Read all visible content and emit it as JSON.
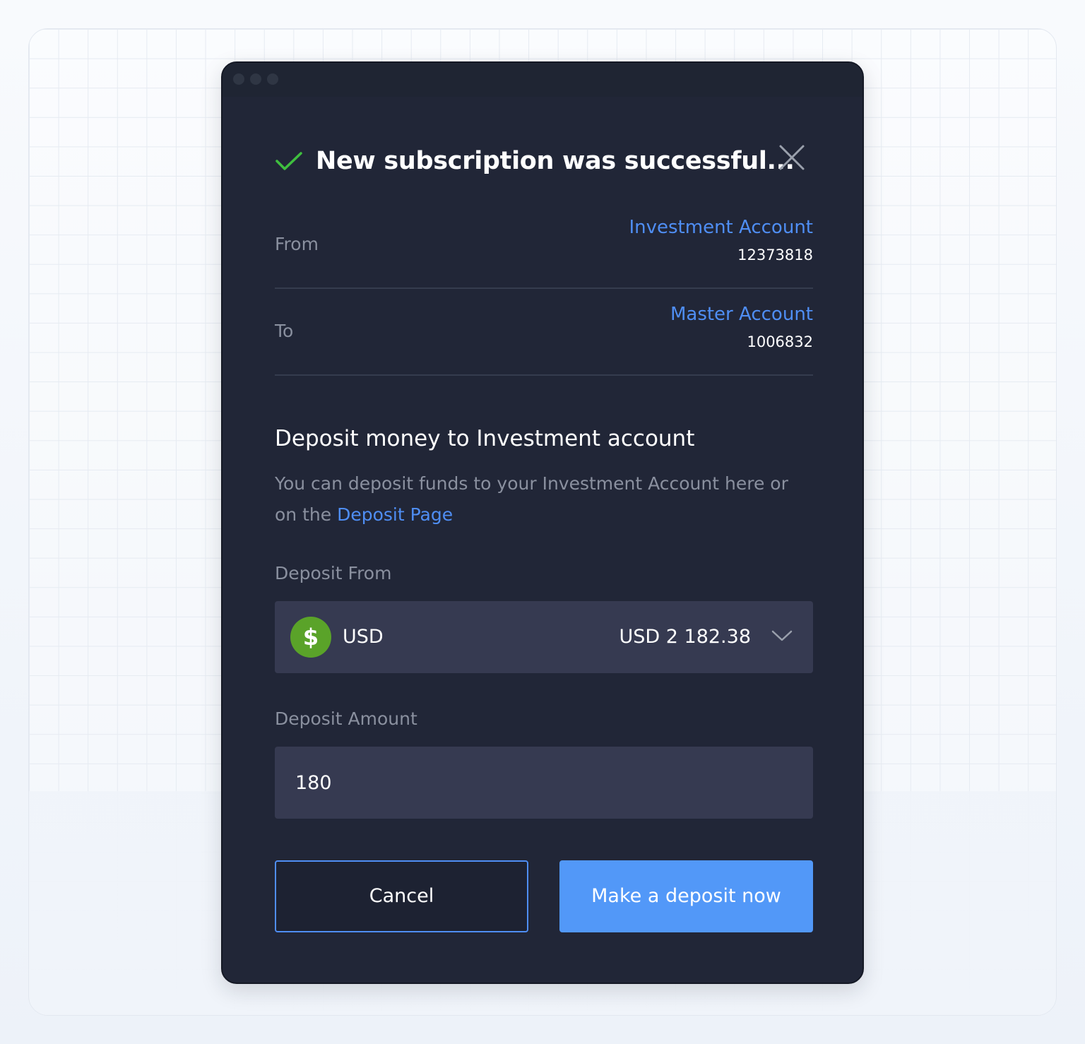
{
  "modal": {
    "title": "New subscription was successful...",
    "from": {
      "label": "From",
      "account_name": "Investment Account",
      "account_number": "12373818"
    },
    "to": {
      "label": "To",
      "account_name": "Master Account",
      "account_number": "1006832"
    },
    "section_title": "Deposit money to Investment account",
    "section_desc_prefix": "You can deposit funds to  your Investment Account here or on the ",
    "section_desc_link": "Deposit Page",
    "deposit_from": {
      "label": "Deposit From",
      "currency_symbol": "$",
      "currency": "USD",
      "balance": "USD 2 182.38"
    },
    "deposit_amount": {
      "label": "Deposit Amount",
      "value": "180"
    },
    "cancel_label": "Cancel",
    "submit_label": "Make a deposit now"
  },
  "icons": {
    "check": "check-icon",
    "close": "close-icon",
    "dropdown": "chevron-down-icon",
    "coin": "dollar-coin-icon"
  },
  "colors": {
    "accent": "#4f8ef4",
    "button_primary": "#5298f8",
    "success": "#3fbf3f",
    "coin": "#5aa329",
    "modal_bg": "#212637",
    "field_bg": "#363a51"
  }
}
